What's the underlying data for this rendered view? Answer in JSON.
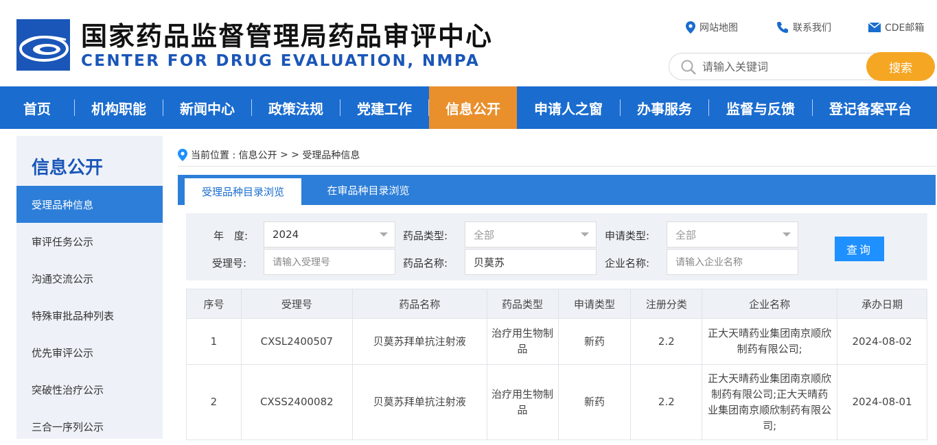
{
  "header": {
    "title_cn": "国家药品监督管理局药品审评中心",
    "title_en": "CENTER FOR DRUG EVALUATION, NMPA",
    "links": [
      "网站地图",
      "联系我们",
      "CDE邮箱"
    ],
    "search_placeholder": "请输入关键词",
    "search_button": "搜索"
  },
  "nav": {
    "items": [
      "首页",
      "机构职能",
      "新闻中心",
      "政策法规",
      "党建工作",
      "信息公开",
      "申请人之窗",
      "办事服务",
      "监督与反馈",
      "登记备案平台"
    ],
    "active_index": 5
  },
  "sidebar": {
    "title": "信息公开",
    "items": [
      "受理品种信息",
      "审评任务公示",
      "沟通交流公示",
      "特殊审批品种列表",
      "优先审评公示",
      "突破性治疗公示",
      "三合一序列公示"
    ],
    "active_index": 0
  },
  "breadcrumb": {
    "prefix": "当前位置 : 信息公开",
    "sep": " > > ",
    "current": "受理品种信息"
  },
  "tabs": [
    "受理品种目录浏览",
    "在审品种目录浏览"
  ],
  "filter": {
    "year_label": "年　度:",
    "year_value": "2024",
    "drug_type_label": "药品类型:",
    "drug_type_value": "全部",
    "apply_type_label": "申请类型:",
    "apply_type_value": "全部",
    "accept_no_label": "受理号:",
    "accept_no_placeholder": "请输入受理号",
    "drug_name_label": "药品名称:",
    "drug_name_value": "贝莫苏",
    "company_label": "企业名称:",
    "company_placeholder": "请输入企业名称",
    "query_button": "查询"
  },
  "table": {
    "headers": [
      "序号",
      "受理号",
      "药品名称",
      "药品类型",
      "申请类型",
      "注册分类",
      "企业名称",
      "承办日期"
    ],
    "rows": [
      [
        "1",
        "CXSL2400507",
        "贝莫苏拜单抗注射液",
        "治疗用生物制品",
        "新药",
        "2.2",
        "正大天晴药业集团南京顺欣制药有限公司;",
        "2024-08-02"
      ],
      [
        "2",
        "CXSS2400082",
        "贝莫苏拜单抗注射液",
        "治疗用生物制品",
        "新药",
        "2.2",
        "正大天晴药业集团南京顺欣制药有限公司;正大天晴药业集团南京顺欣制药有限公司;",
        "2024-08-01"
      ]
    ]
  },
  "colors": {
    "brand_blue": "#1a56b8",
    "nav_blue": "#1a6ccf",
    "accent_orange": "#e98f2c",
    "search_orange": "#f5a623"
  }
}
